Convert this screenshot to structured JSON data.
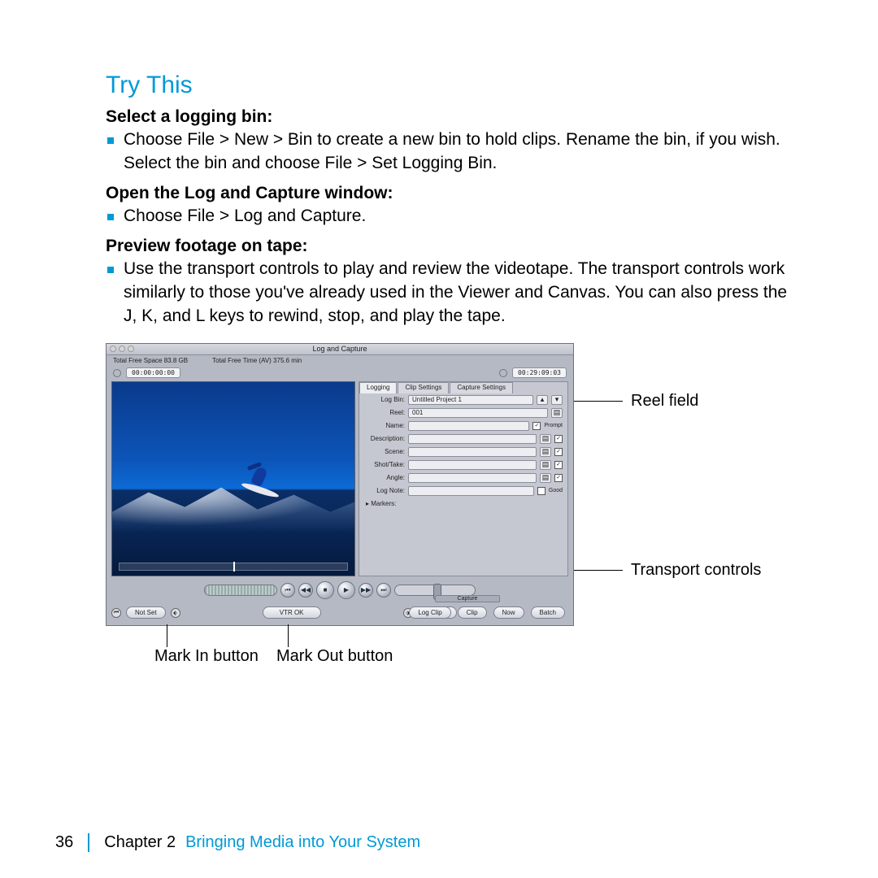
{
  "heading": "Try This",
  "sections": {
    "s1_label": "Select a logging bin:",
    "s1_text": "Choose File > New > Bin to create a new bin to hold clips. Rename the bin, if you wish. Select the bin and choose File > Set Logging Bin.",
    "s2_label": "Open the Log and Capture window:",
    "s2_text": "Choose File > Log and Capture.",
    "s3_label": "Preview footage on tape:",
    "s3_text": "Use the transport controls to play and review the videotape. The transport controls work similarly to those you've already used in the Viewer and Canvas. You can also press the J, K, and L keys to rewind, stop, and play the tape."
  },
  "window": {
    "title": "Log and Capture",
    "free_space": "Total Free Space   83.8 GB",
    "free_time": "Total Free Time   (AV) 375.6 min",
    "tc_in": "00:00:00:00",
    "tc_out": "00:29:09:03",
    "tabs": {
      "t1": "Logging",
      "t2": "Clip Settings",
      "t3": "Capture Settings"
    },
    "form": {
      "logbin_label": "Log Bin:",
      "logbin_value": "Untitled Project 1",
      "reel_label": "Reel:",
      "reel_value": "001",
      "name_label": "Name:",
      "prompt": "Prompt",
      "desc_label": "Description:",
      "scene_label": "Scene:",
      "shot_label": "Shot/Take:",
      "angle_label": "Angle:",
      "lognote_label": "Log Note:",
      "good": "Good",
      "markers": "▸ Markers:"
    },
    "bottom": {
      "notset": "Not Set",
      "vtr": "VTR OK",
      "logclip": "Log Clip",
      "capture": "Capture",
      "clip": "Clip",
      "now": "Now",
      "batch": "Batch"
    }
  },
  "callouts": {
    "reel": "Reel field",
    "transport": "Transport controls",
    "markin": "Mark In button",
    "markout": "Mark Out button"
  },
  "footer": {
    "page": "36",
    "chapter": "Chapter 2",
    "title": "Bringing Media into Your System"
  }
}
